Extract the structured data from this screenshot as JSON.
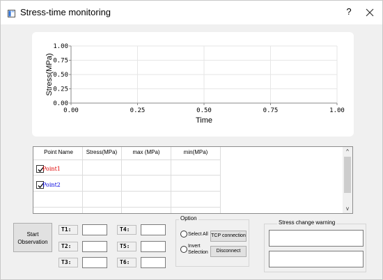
{
  "window": {
    "title": "Stress-time monitoring",
    "help_label": "?"
  },
  "chart_data": {
    "type": "line",
    "title": "",
    "xlabel": "Time",
    "ylabel": "Stress(MPa)",
    "xlim": [
      0,
      1
    ],
    "ylim": [
      0,
      1
    ],
    "xticks": [
      "0.00",
      "0.25",
      "0.50",
      "0.75",
      "1.00"
    ],
    "yticks": [
      "0.00",
      "0.25",
      "0.50",
      "0.75",
      "1.00"
    ],
    "grid": true,
    "series": []
  },
  "table": {
    "columns": [
      "Point Name",
      "Stress(MPa)",
      "max (MPa)",
      "min(MPa)"
    ],
    "rows": [
      {
        "name": "Point1",
        "color": "#e00000",
        "checked": true
      },
      {
        "name": "Point2",
        "color": "#0000e0",
        "checked": true
      }
    ],
    "scroll_up": "^",
    "scroll_down": "v"
  },
  "controls": {
    "start_button": {
      "line1": "Start",
      "line2": "Observation"
    },
    "t_fields": [
      {
        "label": "T1:",
        "value": ""
      },
      {
        "label": "T2:",
        "value": ""
      },
      {
        "label": "T3:",
        "value": ""
      },
      {
        "label": "T4:",
        "value": ""
      },
      {
        "label": "T5:",
        "value": ""
      },
      {
        "label": "T6:",
        "value": ""
      }
    ]
  },
  "option": {
    "title": "Option",
    "select_all": "Select All",
    "invert_line1": "Invert",
    "invert_line2": "Selection",
    "tcp_button": "TCP connection",
    "disconnect_button": "Disconnect"
  },
  "warning": {
    "title": "Stress change warning",
    "field1": "",
    "field2": ""
  }
}
